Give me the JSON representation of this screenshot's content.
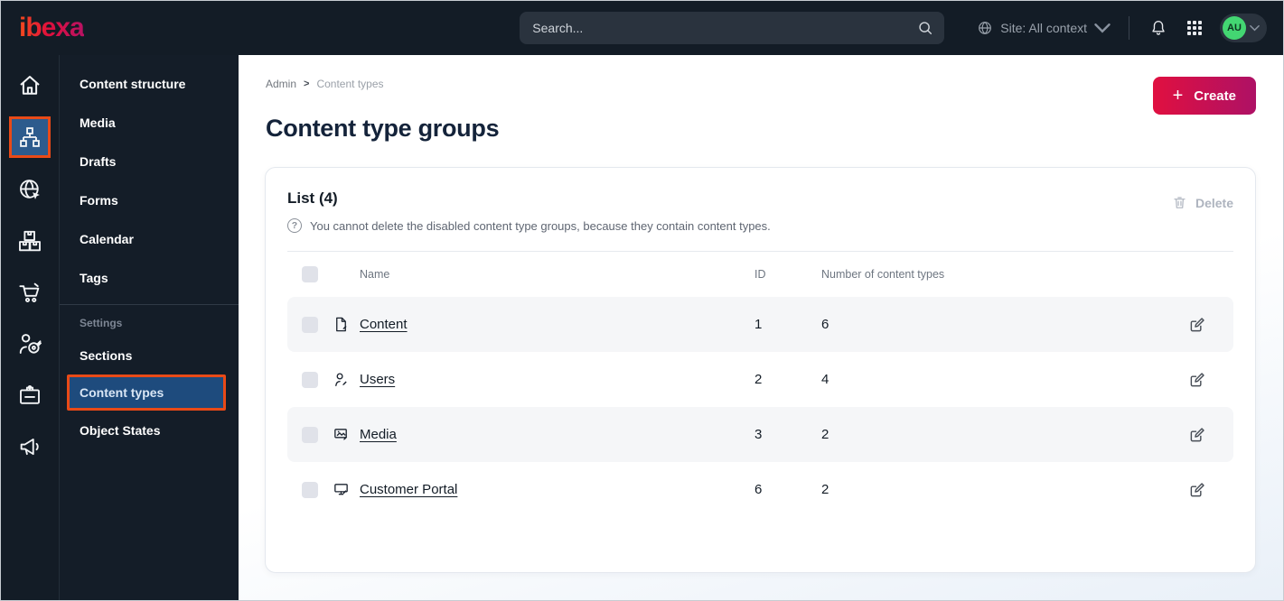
{
  "topbar": {
    "logo": "ibexa",
    "search_placeholder": "Search...",
    "site_context": "Site: All context",
    "avatar_initials": "AU"
  },
  "icon_rail": {
    "items": [
      {
        "icon": "home-icon",
        "active": false
      },
      {
        "icon": "sitemap-icon",
        "active": true,
        "annotated": true
      },
      {
        "icon": "globe-cursor-icon",
        "active": false
      },
      {
        "icon": "boxes-icon",
        "active": false
      },
      {
        "icon": "cart-icon",
        "active": false
      },
      {
        "icon": "person-target-icon",
        "active": false
      },
      {
        "icon": "id-badge-icon",
        "active": false
      },
      {
        "icon": "megaphone-icon",
        "active": false
      }
    ]
  },
  "sidebar": {
    "items": [
      "Content structure",
      "Media",
      "Drafts",
      "Forms",
      "Calendar",
      "Tags"
    ],
    "section_label": "Settings",
    "settings_items": [
      {
        "label": "Sections",
        "active": false
      },
      {
        "label": "Content types",
        "active": true,
        "annotated": true
      },
      {
        "label": "Object States",
        "active": false
      }
    ]
  },
  "breadcrumb": {
    "root": "Admin",
    "separator": ">",
    "current": "Content types"
  },
  "page": {
    "title": "Content type groups",
    "create_label": "Create",
    "create_plus": "+"
  },
  "list_card": {
    "title": "List (4)",
    "info_icon": "?",
    "info": "You cannot delete the disabled content type groups, because they contain content types.",
    "delete_label": "Delete",
    "table": {
      "columns": {
        "name": "Name",
        "id": "ID",
        "count": "Number of content types"
      },
      "rows": [
        {
          "name": "Content",
          "icon": "file-icon",
          "id": "1",
          "count": "6"
        },
        {
          "name": "Users",
          "icon": "user-icon",
          "id": "2",
          "count": "4"
        },
        {
          "name": "Media",
          "icon": "image-icon",
          "id": "3",
          "count": "2"
        },
        {
          "name": "Customer Portal",
          "icon": "monitor-icon",
          "id": "6",
          "count": "2"
        }
      ]
    }
  },
  "colors": {
    "topbar_bg": "#131c26",
    "annotation_orange": "#e94a17",
    "active_blue": "#1e4b7d",
    "active_tile_blue": "#2d5b8d",
    "brand_gradient_start": "#e01040",
    "brand_gradient_end": "#ae1165",
    "avatar_green": "#43d672",
    "row_shade": "#f5f6f8"
  }
}
